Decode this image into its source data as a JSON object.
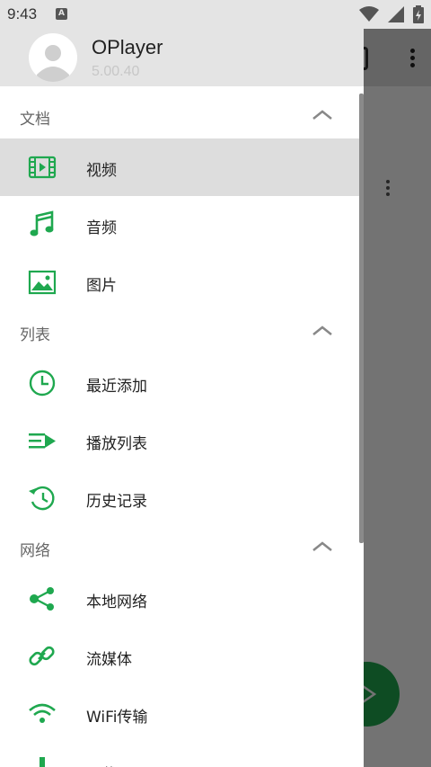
{
  "status_bar": {
    "time": "9:43",
    "notification_glyph": "A"
  },
  "header": {
    "app_name": "OPlayer",
    "version": "5.00.40"
  },
  "sections": {
    "documents": {
      "title": "文档",
      "items": {
        "video": "视频",
        "audio": "音频",
        "image": "图片"
      }
    },
    "lists": {
      "title": "列表",
      "items": {
        "recent": "最近添加",
        "playlist": "播放列表",
        "history": "历史记录"
      }
    },
    "network": {
      "title": "网络",
      "items": {
        "local": "本地网络",
        "stream": "流媒体",
        "wifi": "WiFi传输",
        "download": "下载"
      }
    }
  },
  "active_item": "video",
  "colors": {
    "accent": "#1fa84f",
    "active_bg": "#dddddd",
    "header_bg": "#e4e4e4"
  }
}
